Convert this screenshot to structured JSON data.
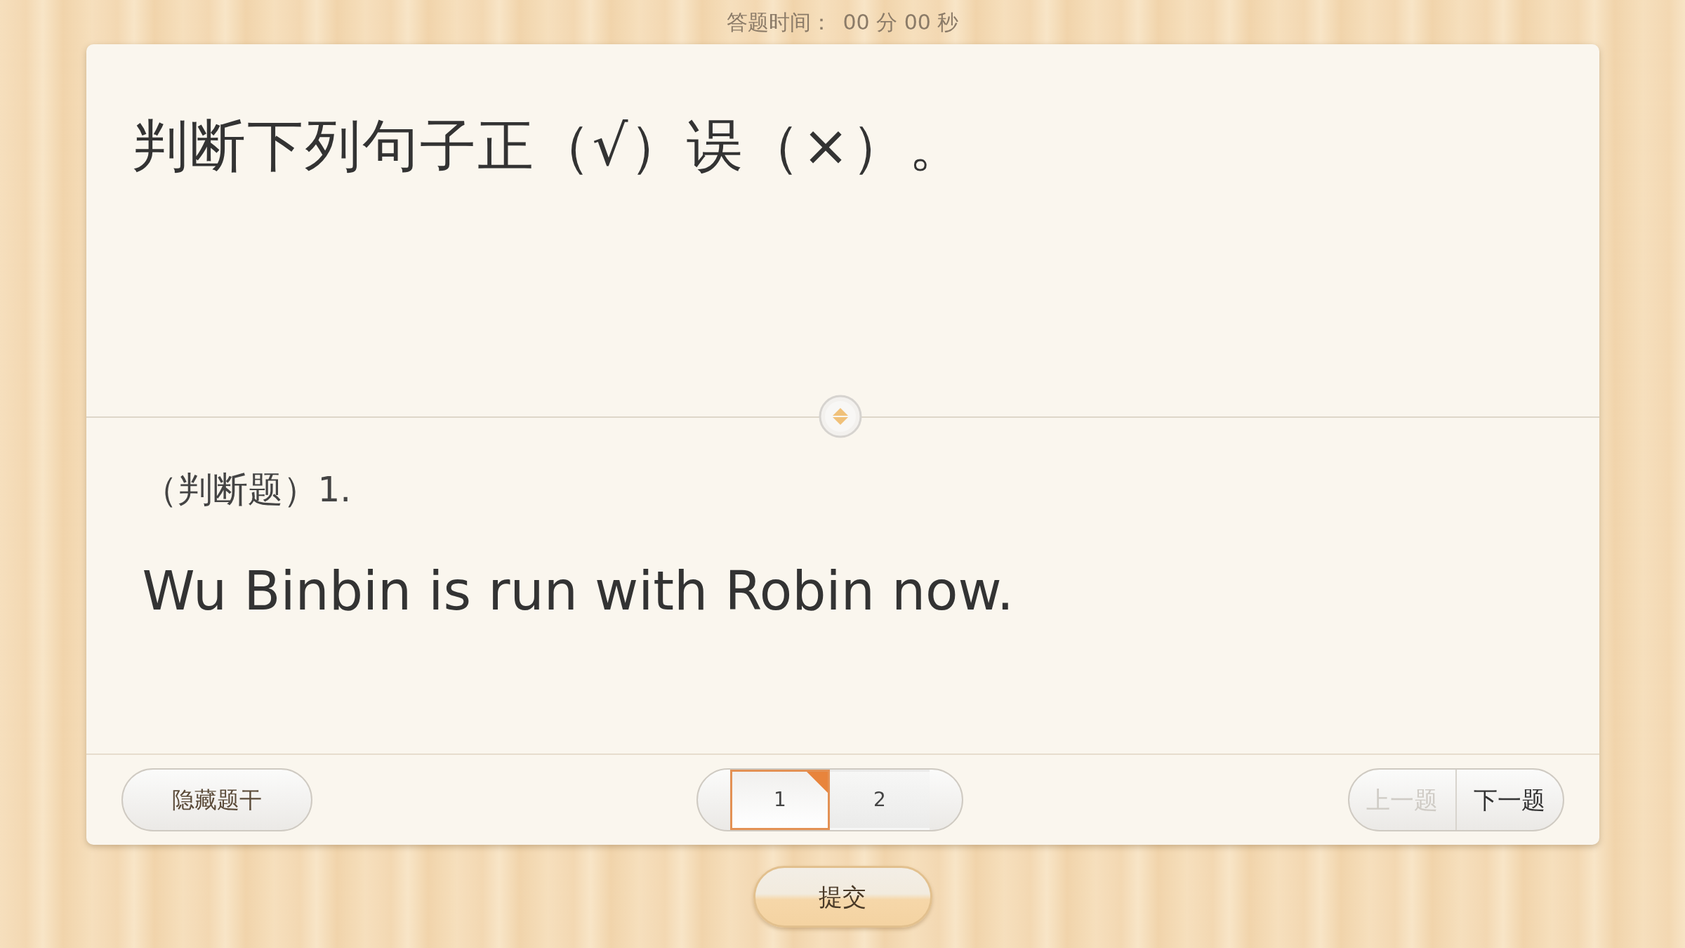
{
  "timer": {
    "label": "答题时间：",
    "value": "00 分 00 秒"
  },
  "stem": {
    "text": "判断下列句子正（√）误（×）。"
  },
  "question": {
    "type_label": "（判断题）1.",
    "text": "Wu Binbin is run with Robin now."
  },
  "footer": {
    "hide_button": "隐藏题干",
    "pages": [
      {
        "label": "1",
        "selected": true
      },
      {
        "label": "2",
        "selected": false
      }
    ],
    "prev": {
      "label": "上一题",
      "disabled": true
    },
    "next": {
      "label": "下一题",
      "disabled": false
    }
  },
  "submit": "提交"
}
